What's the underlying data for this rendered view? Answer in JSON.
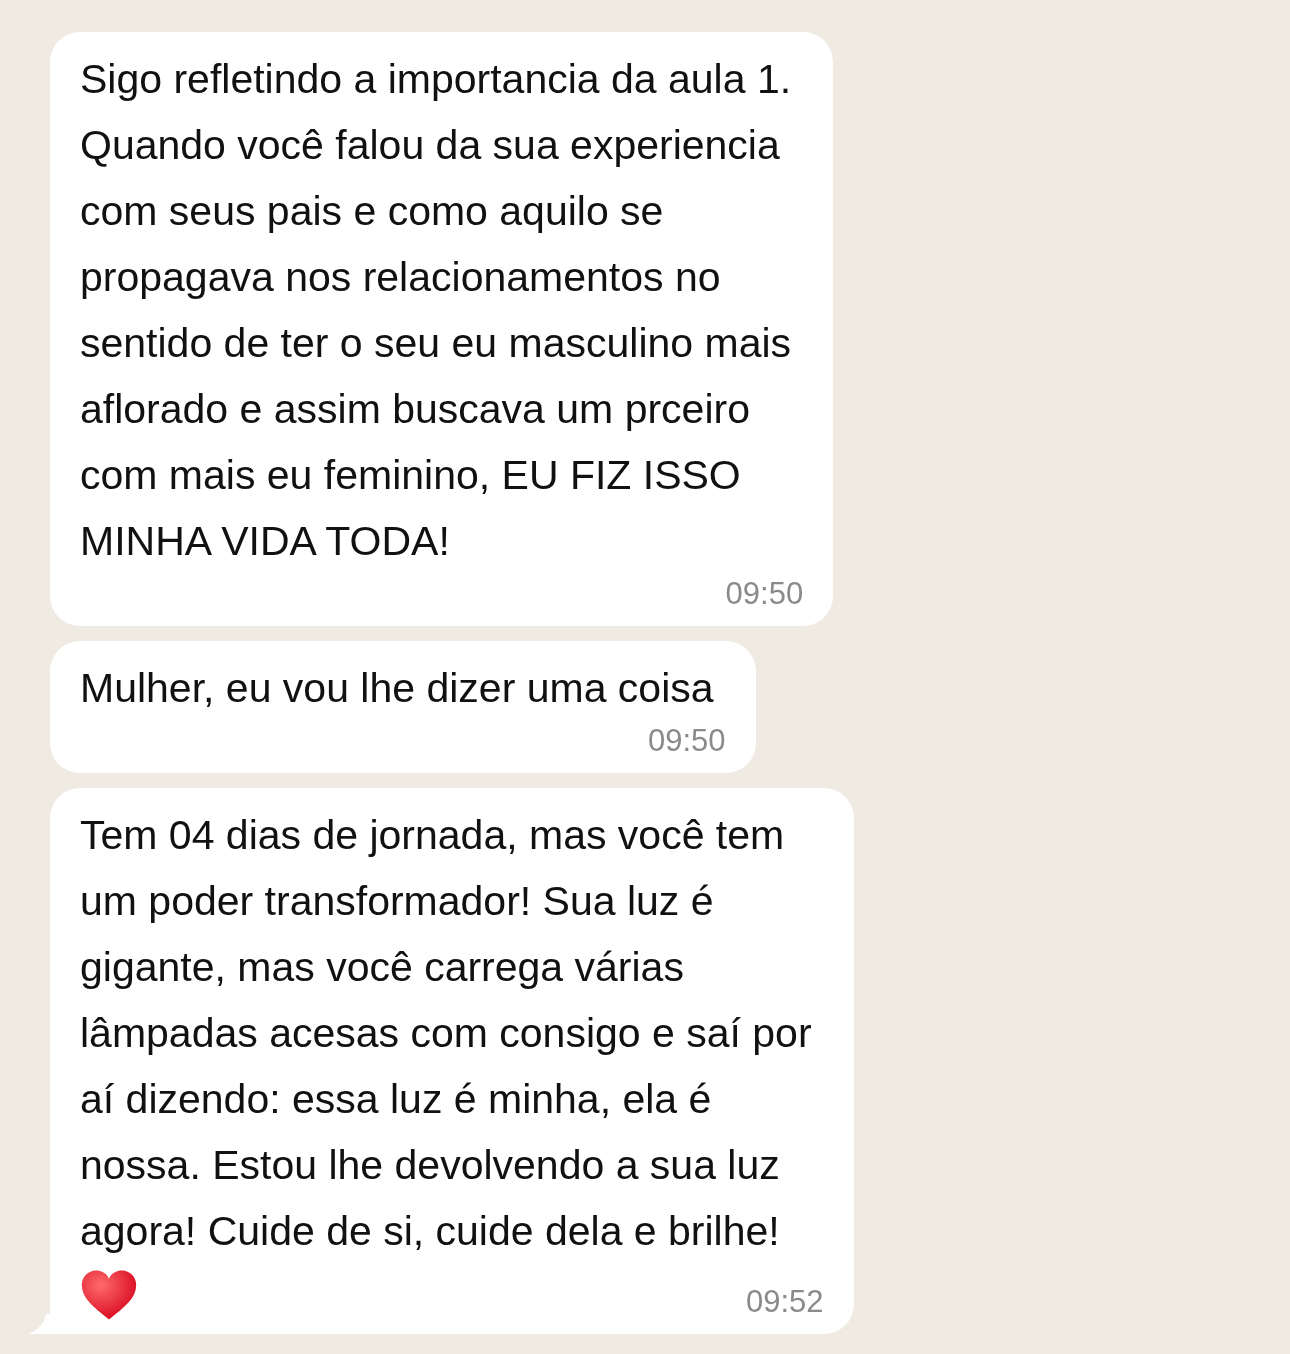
{
  "messages": [
    {
      "text": "Sigo refletindo a importancia da aula 1.\nQuando você falou da sua experiencia\ncom seus pais e como aquilo se\npropagava nos relacionamentos no\nsentido de ter o seu eu masculino mais\naflorado e assim buscava um prceiro\ncom mais eu feminino, EU FIZ ISSO\nMINHA VIDA TODA!",
      "time": "09:50",
      "heart": false,
      "tail": false
    },
    {
      "text": "Mulher, eu vou lhe dizer uma coisa",
      "time": "09:50",
      "heart": false,
      "tail": false
    },
    {
      "text": "Tem 04 dias de jornada, mas você tem\num poder transformador! Sua luz é\ngigante, mas você carrega várias\nlâmpadas acesas com consigo e saí por\naí dizendo: essa luz é minha, ela é\nnossa. Estou lhe devolvendo a sua luz\nagora! Cuide de si, cuide dela e brilhe!",
      "time": "09:52",
      "heart": true,
      "tail": true
    }
  ]
}
